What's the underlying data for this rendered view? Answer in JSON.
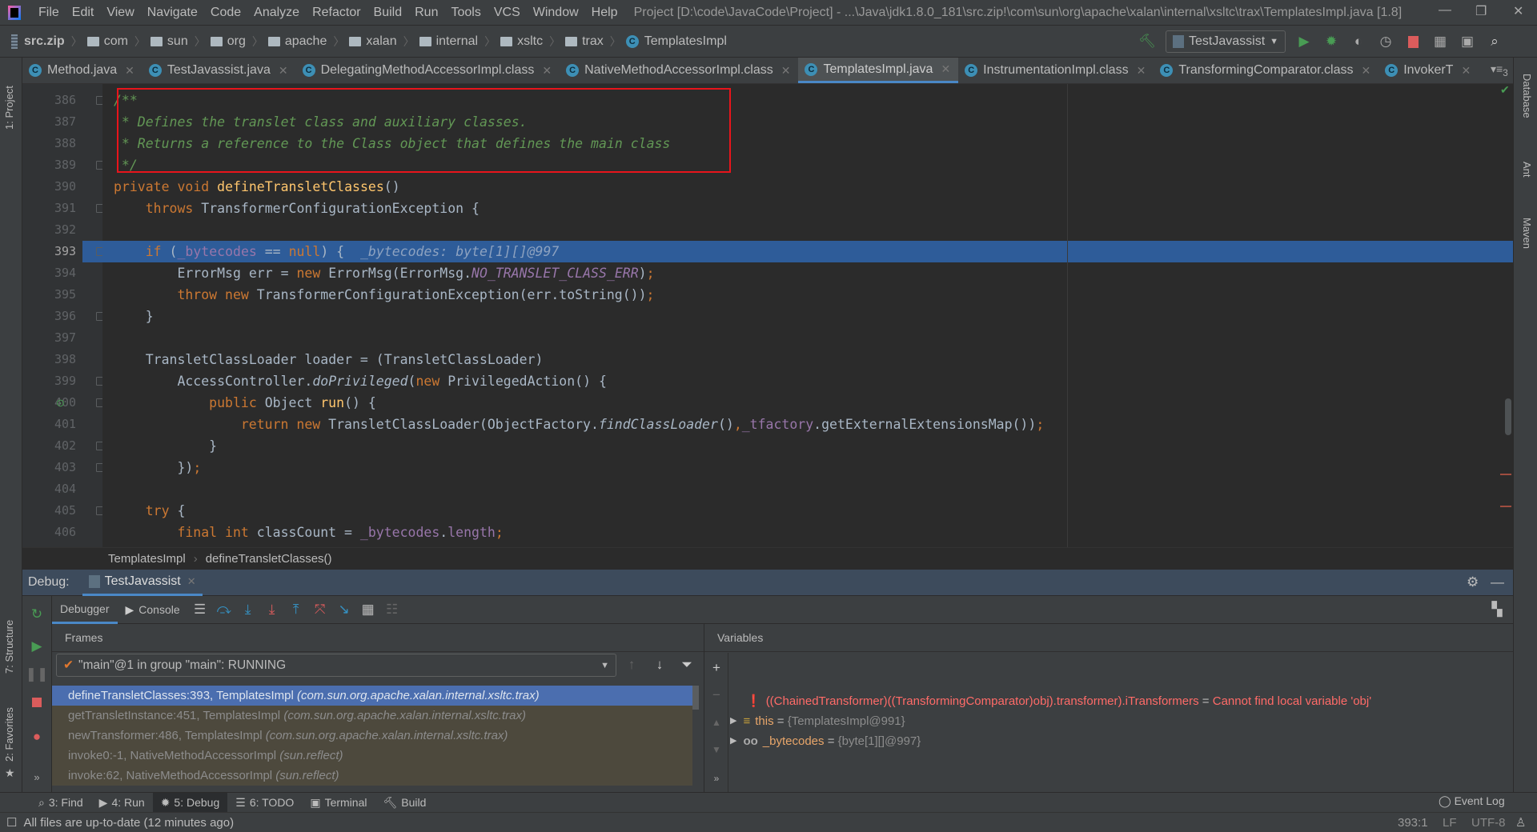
{
  "menubar": {
    "items": [
      "File",
      "Edit",
      "View",
      "Navigate",
      "Code",
      "Analyze",
      "Refactor",
      "Build",
      "Run",
      "Tools",
      "VCS",
      "Window",
      "Help"
    ],
    "title": "Project [D:\\code\\JavaCode\\Project] - ...\\Java\\jdk1.8.0_181\\src.zip!\\com\\sun\\org\\apache\\xalan\\internal\\xsltc\\trax\\TemplatesImpl.java [1.8]"
  },
  "navbar": {
    "root": "src.zip",
    "folders": [
      "com",
      "sun",
      "org",
      "apache",
      "xalan",
      "internal",
      "xsltc",
      "trax"
    ],
    "file": "TemplatesImpl",
    "run_config": "TestJavassist"
  },
  "tabs": [
    {
      "label": "Method.java",
      "active": false
    },
    {
      "label": "TestJavassist.java",
      "active": false
    },
    {
      "label": "DelegatingMethodAccessorImpl.class",
      "active": false
    },
    {
      "label": "NativeMethodAccessorImpl.class",
      "active": false
    },
    {
      "label": "TemplatesImpl.java",
      "active": true
    },
    {
      "label": "InstrumentationImpl.class",
      "active": false
    },
    {
      "label": "TransformingComparator.class",
      "active": false
    },
    {
      "label": "InvokerT",
      "active": false
    }
  ],
  "tabs_overflow": "3",
  "left_strip": {
    "project": "1: Project",
    "structure": "7: Structure",
    "favorites": "2: Favorites"
  },
  "right_strip": {
    "database": "Database",
    "ant": "Ant",
    "maven": "Maven"
  },
  "colors": {
    "keyword": "#cc7832",
    "comment": "#629755",
    "method": "#ffc66d",
    "field": "#9876aa",
    "text": "#a9b7c6",
    "current_line": "#2e5c99",
    "annotation_box": "#e8141b",
    "error": "#ff6b68"
  },
  "editor": {
    "current_line": 393,
    "lines": [
      {
        "n": 386,
        "indent": 0,
        "tokens": [
          [
            "cmt",
            "/**"
          ]
        ]
      },
      {
        "n": 387,
        "indent": 0,
        "tokens": [
          [
            "cmt",
            " * Defines the translet class and auxiliary classes."
          ]
        ]
      },
      {
        "n": 388,
        "indent": 0,
        "tokens": [
          [
            "cmt",
            " * Returns a reference to the Class object that defines the main class"
          ]
        ]
      },
      {
        "n": 389,
        "indent": 0,
        "tokens": [
          [
            "cmt",
            " */"
          ]
        ]
      },
      {
        "n": 390,
        "indent": 0,
        "tokens": [
          [
            "kw",
            "private void "
          ],
          [
            "fn",
            "defineTransletClasses"
          ],
          [
            "plain",
            "()"
          ]
        ]
      },
      {
        "n": 391,
        "indent": 4,
        "tokens": [
          [
            "kw",
            "throws "
          ],
          [
            "plain",
            "TransformerConfigurationException {"
          ]
        ]
      },
      {
        "n": 392,
        "indent": 0,
        "tokens": []
      },
      {
        "n": 393,
        "indent": 4,
        "tokens": [
          [
            "kw",
            "if "
          ],
          [
            "plain",
            "("
          ],
          [
            "field",
            "_bytecodes"
          ],
          [
            "plain",
            " == "
          ],
          [
            "kw",
            "null"
          ],
          [
            "plain",
            ") {  "
          ],
          [
            "hint",
            "_bytecodes: byte[1][]@997"
          ]
        ]
      },
      {
        "n": 394,
        "indent": 8,
        "tokens": [
          [
            "plain",
            "ErrorMsg err = "
          ],
          [
            "kw",
            "new "
          ],
          [
            "plain",
            "ErrorMsg(ErrorMsg."
          ],
          [
            "static",
            "NO_TRANSLET_CLASS_ERR"
          ],
          [
            "plain",
            ")"
          ],
          [
            "kw",
            ";"
          ]
        ]
      },
      {
        "n": 395,
        "indent": 8,
        "tokens": [
          [
            "kw",
            "throw new "
          ],
          [
            "plain",
            "TransformerConfigurationException(err.toString())"
          ],
          [
            "kw",
            ";"
          ]
        ]
      },
      {
        "n": 396,
        "indent": 4,
        "tokens": [
          [
            "plain",
            "}"
          ]
        ]
      },
      {
        "n": 397,
        "indent": 0,
        "tokens": []
      },
      {
        "n": 398,
        "indent": 4,
        "tokens": [
          [
            "plain",
            "TransletClassLoader loader = (TransletClassLoader)"
          ]
        ]
      },
      {
        "n": 399,
        "indent": 8,
        "tokens": [
          [
            "plain",
            "AccessController."
          ],
          [
            "italic",
            "doPrivileged"
          ],
          [
            "plain",
            "("
          ],
          [
            "kw",
            "new "
          ],
          [
            "plain",
            "PrivilegedAction() {"
          ]
        ]
      },
      {
        "n": 400,
        "indent": 12,
        "tokens": [
          [
            "kw",
            "public "
          ],
          [
            "plain",
            "Object "
          ],
          [
            "fn",
            "run"
          ],
          [
            "plain",
            "() {"
          ]
        ]
      },
      {
        "n": 401,
        "indent": 16,
        "tokens": [
          [
            "kw",
            "return new "
          ],
          [
            "plain",
            "TransletClassLoader(ObjectFactory."
          ],
          [
            "italic",
            "findClassLoader"
          ],
          [
            "plain",
            "()"
          ],
          [
            "kw",
            ","
          ],
          [
            "field",
            "_tfactory"
          ],
          [
            "plain",
            ".getExternalExtensionsMap())"
          ],
          [
            "kw",
            ";"
          ]
        ]
      },
      {
        "n": 402,
        "indent": 12,
        "tokens": [
          [
            "plain",
            "}"
          ]
        ]
      },
      {
        "n": 403,
        "indent": 8,
        "tokens": [
          [
            "plain",
            "})"
          ],
          [
            "kw",
            ";"
          ]
        ]
      },
      {
        "n": 404,
        "indent": 0,
        "tokens": []
      },
      {
        "n": 405,
        "indent": 4,
        "tokens": [
          [
            "kw",
            "try "
          ],
          [
            "plain",
            "{"
          ]
        ]
      },
      {
        "n": 406,
        "indent": 8,
        "tokens": [
          [
            "kw",
            "final int "
          ],
          [
            "plain",
            "classCount = "
          ],
          [
            "field",
            "_bytecodes"
          ],
          [
            "plain",
            "."
          ],
          [
            "field",
            "length"
          ],
          [
            "kw",
            ";"
          ]
        ]
      }
    ],
    "folds": [
      386,
      389,
      391,
      393,
      396,
      399,
      400,
      402,
      403,
      405
    ],
    "breadcrumb": [
      "TemplatesImpl",
      "defineTransletClasses()"
    ]
  },
  "debug": {
    "label": "Debug:",
    "session": "TestJavassist",
    "subtabs": [
      "Debugger",
      "Console"
    ],
    "frames_title": "Frames",
    "variables_title": "Variables",
    "thread": "\"main\"@1 in group \"main\": RUNNING",
    "frames": [
      {
        "method": "defineTransletClasses:393, TemplatesImpl",
        "pkg": "(com.sun.org.apache.xalan.internal.xsltc.trax)",
        "selected": true
      },
      {
        "method": "getTransletInstance:451, TemplatesImpl",
        "pkg": "(com.sun.org.apache.xalan.internal.xsltc.trax)",
        "selected": false
      },
      {
        "method": "newTransformer:486, TemplatesImpl",
        "pkg": "(com.sun.org.apache.xalan.internal.xsltc.trax)",
        "selected": false
      },
      {
        "method": "invoke0:-1, NativeMethodAccessorImpl",
        "pkg": "(sun.reflect)",
        "selected": false
      },
      {
        "method": "invoke:62, NativeMethodAccessorImpl",
        "pkg": "(sun.reflect)",
        "selected": false
      }
    ],
    "variables": [
      {
        "icon": "error-icon",
        "name": "((ChainedTransformer)((TransformingComparator)obj).transformer).iTransformers",
        "eq": " = ",
        "value": "Cannot find local variable 'obj'",
        "error": true
      },
      {
        "icon": "field-icon",
        "name": "this",
        "eq": " = ",
        "value": "{TemplatesImpl@991}",
        "error": false
      },
      {
        "icon": "watch-icon",
        "name": "_bytecodes",
        "eq": " = ",
        "value": "{byte[1][]@997}",
        "error": false
      }
    ]
  },
  "bottom_tabs": [
    {
      "label": "3: Find",
      "icon": "search-icon"
    },
    {
      "label": "4: Run",
      "icon": "run-icon"
    },
    {
      "label": "5: Debug",
      "icon": "bug-icon",
      "active": true
    },
    {
      "label": "6: TODO",
      "icon": "list-icon"
    },
    {
      "label": "Terminal",
      "icon": "terminal-icon"
    },
    {
      "label": "Build",
      "icon": "hammer-icon"
    }
  ],
  "event_log": "Event Log",
  "status": {
    "message": "All files are up-to-date (12 minutes ago)",
    "position": "393:1",
    "line_sep": "LF",
    "encoding": "UTF-8"
  }
}
